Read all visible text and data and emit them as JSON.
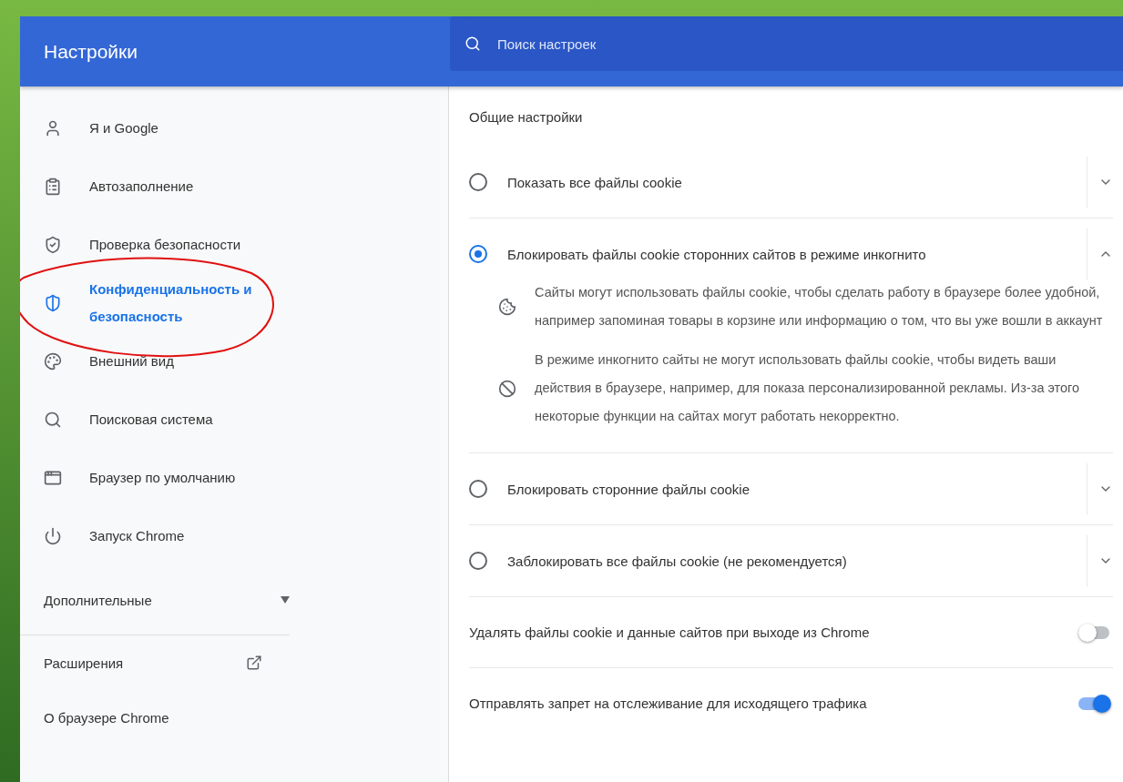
{
  "header": {
    "title": "Настройки",
    "search": {
      "placeholder": "Поиск настроек"
    }
  },
  "sidebar": {
    "items": [
      {
        "label": "Я и Google",
        "selected": false
      },
      {
        "label": "Автозаполнение",
        "selected": false
      },
      {
        "label": "Проверка безопасности",
        "selected": false
      },
      {
        "label": "Конфиденциальность и безопасность",
        "selected": true
      },
      {
        "label": "Внешний вид",
        "selected": false
      },
      {
        "label": "Поисковая система",
        "selected": false
      },
      {
        "label": "Браузер по умолчанию",
        "selected": false
      },
      {
        "label": "Запуск Chrome",
        "selected": false
      }
    ],
    "advanced": {
      "label": "Дополнительные",
      "expanded": false
    },
    "links": [
      {
        "label": "Расширения",
        "external": true
      },
      {
        "label": "О браузере Chrome",
        "external": false
      }
    ]
  },
  "main": {
    "section_title": "Общие настройки",
    "options": [
      {
        "label": "Показать все файлы cookie",
        "selected": false,
        "expanded": false
      },
      {
        "label": "Блокировать файлы cookie сторонних сайтов в режиме инкогнито",
        "selected": true,
        "expanded": true,
        "details": [
          {
            "text": "Сайты могут использовать файлы cookie, чтобы сделать работу в браузере более удобной, например запоминая товары в корзине или информацию о том, что вы уже вошли в аккаунт"
          },
          {
            "text": "В режиме инкогнито сайты не могут использовать файлы cookie, чтобы видеть ваши действия в браузере, например, для показа персонализированной рекламы. Из-за этого некоторые функции на сайтах могут работать некорректно."
          }
        ]
      },
      {
        "label": "Блокировать сторонние файлы cookie",
        "selected": false,
        "expanded": false
      },
      {
        "label": "Заблокировать все файлы cookie (не рекомендуется)",
        "selected": false,
        "expanded": false
      }
    ],
    "toggles": [
      {
        "label": "Удалять файлы cookie и данные сайтов при выходе из Chrome",
        "on": false
      },
      {
        "label": "Отправлять запрет на отслеживание для исходящего трафика",
        "on": true
      }
    ]
  }
}
